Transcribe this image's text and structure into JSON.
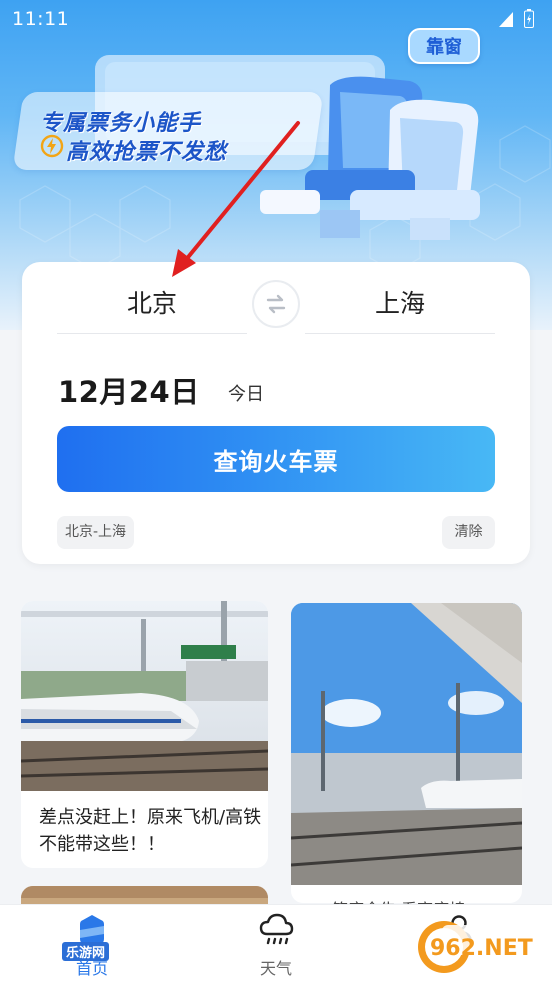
{
  "status_bar": {
    "time": "11:11"
  },
  "hero": {
    "slogan_line1": "专属票务小能手",
    "slogan_line2": "高效抢票不发愁",
    "window_tag": "靠窗"
  },
  "search": {
    "from_city": "北京",
    "to_city": "上海",
    "date": "12月24日",
    "date_hint": "今日",
    "search_button": "查询火车票",
    "history_chip": "北京-上海",
    "clear_chip": "清除"
  },
  "feed": {
    "items": [
      {
        "title": "差点没赶上！原来飞机/高铁不能带这些！！"
      },
      {
        "title": "一等座全告·看高座椅"
      }
    ]
  },
  "bottom_nav": {
    "items": [
      {
        "label": "首页",
        "icon": "home-icon",
        "active": true
      },
      {
        "label": "天气",
        "icon": "weather-cloud-rain-icon",
        "active": false
      },
      {
        "label": "",
        "icon": "profile-icon",
        "active": false
      }
    ]
  },
  "watermark": {
    "text": "962.NET",
    "subtext": "乐游网"
  },
  "colors": {
    "accent": "#2a78e8",
    "button_gradient_start": "#1f6ff0",
    "button_gradient_end": "#48b8f5",
    "annotation_arrow": "#e02020"
  }
}
